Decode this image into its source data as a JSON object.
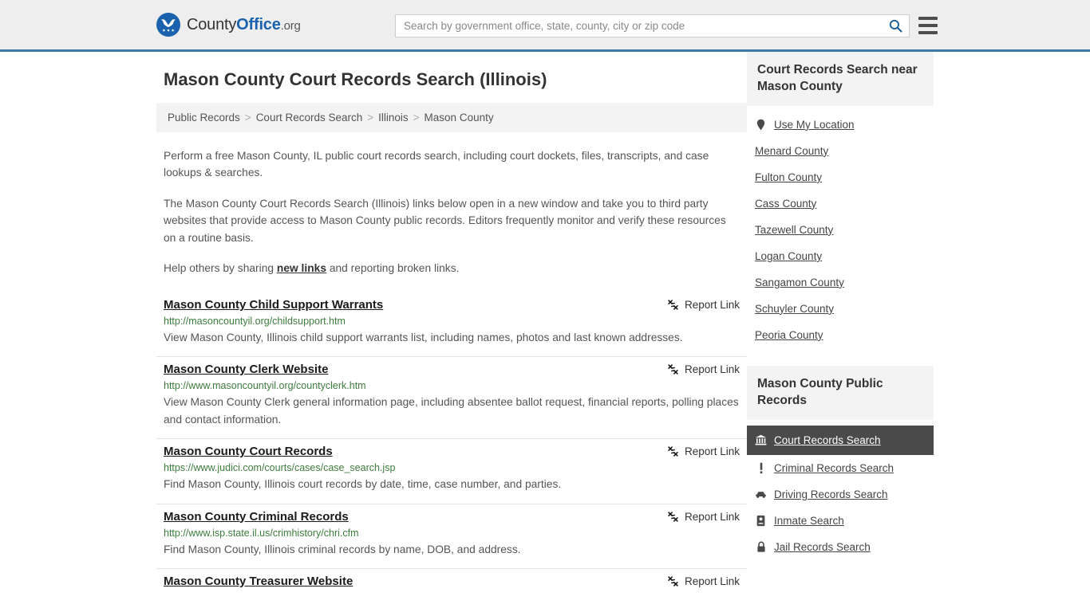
{
  "header": {
    "brand": {
      "part1": "County",
      "part2": "Office",
      "tld": ".org",
      "logo_icon": "eagle-stars-logo"
    },
    "search": {
      "placeholder": "Search by government office, state, county, city or zip code",
      "value": "",
      "icon": "search-icon"
    },
    "menu_icon": "hamburger-menu-icon",
    "accent_color": "#3b7bab"
  },
  "page_title": "Mason County Court Records Search (Illinois)",
  "breadcrumb": {
    "items": [
      {
        "label": "Public Records"
      },
      {
        "label": "Court Records Search"
      },
      {
        "label": "Illinois"
      },
      {
        "label": "Mason County"
      }
    ],
    "separator": ">"
  },
  "intro": {
    "p1": "Perform a free Mason County, IL public court records search, including court dockets, files, transcripts, and case lookups & searches.",
    "p2": "The Mason County Court Records Search (Illinois) links below open in a new window and take you to third party websites that provide access to Mason County public records. Editors frequently monitor and verify these resources on a routine basis.",
    "p3_before": "Help others by sharing ",
    "p3_link": "new links",
    "p3_after": " and reporting broken links."
  },
  "results": {
    "report_label": "Report Link",
    "report_icon": "broken-link-icon",
    "items": [
      {
        "title": "Mason County Child Support Warrants",
        "url": "http://masoncountyil.org/childsupport.htm",
        "description": "View Mason County, Illinois child support warrants list, including names, photos and last known addresses."
      },
      {
        "title": "Mason County Clerk Website",
        "url": "http://www.masoncountyil.org/countyclerk.htm",
        "description": "View Mason County Clerk general information page, including absentee ballot request, financial reports, polling places and contact information."
      },
      {
        "title": "Mason County Court Records",
        "url": "https://www.judici.com/courts/cases/case_search.jsp",
        "description": "Find Mason County, Illinois court records by date, time, case number, and parties."
      },
      {
        "title": "Mason County Criminal Records",
        "url": "http://www.isp.state.il.us/crimhistory/chri.cfm",
        "description": "Find Mason County, Illinois criminal records by name, DOB, and address."
      },
      {
        "title": "Mason County Treasurer Website",
        "url": "",
        "description": ""
      }
    ]
  },
  "sidebar": {
    "nearby": {
      "heading": "Court Records Search near Mason County",
      "items": [
        {
          "label": "Use My Location",
          "icon": "map-pin-icon"
        },
        {
          "label": "Menard County",
          "icon": ""
        },
        {
          "label": "Fulton County",
          "icon": ""
        },
        {
          "label": "Cass County",
          "icon": ""
        },
        {
          "label": "Tazewell County",
          "icon": ""
        },
        {
          "label": "Logan County",
          "icon": ""
        },
        {
          "label": "Sangamon County",
          "icon": ""
        },
        {
          "label": "Schuyler County",
          "icon": ""
        },
        {
          "label": "Peoria County",
          "icon": ""
        }
      ]
    },
    "public_records": {
      "heading": "Mason County Public Records",
      "active_bg": "#4a4a4a",
      "items": [
        {
          "label": "Court Records Search",
          "icon": "courthouse-icon",
          "active": true
        },
        {
          "label": "Criminal Records Search",
          "icon": "exclamation-icon",
          "active": false
        },
        {
          "label": "Driving Records Search",
          "icon": "car-icon",
          "active": false
        },
        {
          "label": "Inmate Search",
          "icon": "id-badge-icon",
          "active": false
        },
        {
          "label": "Jail Records Search",
          "icon": "lock-icon",
          "active": false
        }
      ]
    }
  }
}
